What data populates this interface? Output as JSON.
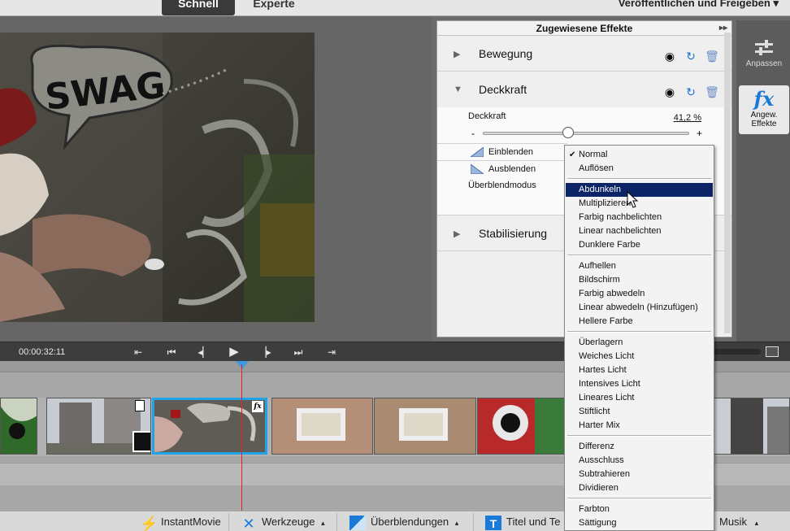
{
  "topbar": {
    "tabs": [
      {
        "label": "Schnell",
        "active": true
      },
      {
        "label": "Experte",
        "active": false
      }
    ],
    "publish_label": "Veröffentlichen und Freigeben",
    "publish_chevron": "▾"
  },
  "transport": {
    "timecode": "00:00:32:11",
    "buttons": [
      "go-start-marker",
      "skip-back",
      "frame-back",
      "play",
      "frame-forward",
      "skip-forward",
      "go-end-marker"
    ]
  },
  "effects_panel": {
    "title": "Zugewiesene Effekte",
    "effects": [
      {
        "name": "Bewegung",
        "expanded": false
      },
      {
        "name": "Deckkraft",
        "expanded": true
      },
      {
        "name": "Stabilisierung",
        "expanded": false
      }
    ],
    "opacity": {
      "label": "Deckkraft",
      "value_text": "41,2 %",
      "value": 41.2,
      "minus": "-",
      "plus": "+",
      "fade_in": "Einblenden",
      "fade_out": "Ausblenden",
      "blend_mode_label": "Überblendmodus"
    }
  },
  "sidebar": {
    "adjust_label": "Anpassen",
    "applied_label_line1": "Angew.",
    "applied_label_line2": "Effekte",
    "fx_glyph": "fx"
  },
  "blend_menu": {
    "checked": "Normal",
    "highlighted": "Abdunkeln",
    "groups": [
      [
        "Normal",
        "Auflösen"
      ],
      [
        "Abdunkeln",
        "Multiplizieren",
        "Farbig nachbelichten",
        "Linear nachbelichten",
        "Dunklere Farbe"
      ],
      [
        "Aufhellen",
        "Bildschirm",
        "Farbig abwedeln",
        "Linear abwedeln (Hinzufügen)",
        "Hellere Farbe"
      ],
      [
        "Überlagern",
        "Weiches Licht",
        "Hartes Licht",
        "Intensives Licht",
        "Lineares Licht",
        "Stiftlicht",
        "Harter Mix"
      ],
      [
        "Differenz",
        "Ausschluss",
        "Subtrahieren",
        "Dividieren"
      ],
      [
        "Farbton",
        "Sättigung"
      ]
    ]
  },
  "preview": {
    "graffiti_text": "SWAG"
  },
  "bottombar": {
    "items": [
      {
        "label": "InstantMovie"
      },
      {
        "label": "Werkzeuge",
        "chevron": "▴"
      },
      {
        "label": "Überblendungen",
        "chevron": "▴"
      },
      {
        "label": "Titel und Te"
      },
      {
        "label": "Musik",
        "chevron": "▴"
      }
    ]
  },
  "colors": {
    "accent": "#0b2466",
    "clip_selected": "#1fa3e8",
    "playline": "#e02424"
  }
}
